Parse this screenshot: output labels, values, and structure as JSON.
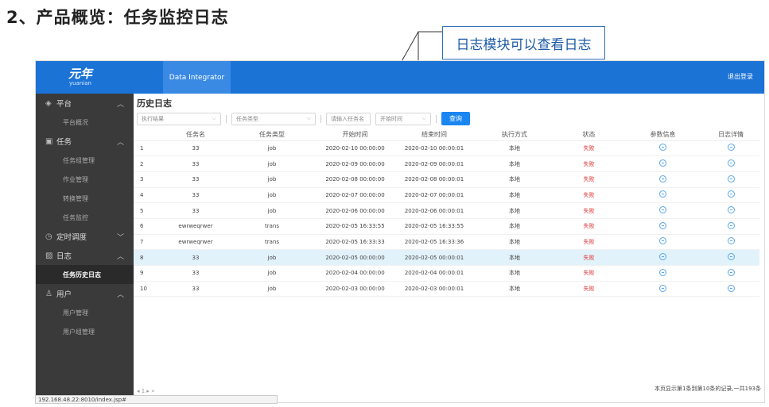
{
  "slide": {
    "title": "2、产品概览：任务监控日志"
  },
  "callout": {
    "text": "日志模块可以查看日志"
  },
  "app": {
    "logo": {
      "zh": "元年",
      "en": "yuanian"
    },
    "product_tab": "Data Integrator",
    "logout": "退出登录"
  },
  "sidebar": {
    "groups": [
      {
        "label": "平台",
        "icon": "layers-icon",
        "chevron": "up",
        "items": [
          {
            "label": "平台概况"
          }
        ]
      },
      {
        "label": "任务",
        "icon": "calendar-icon",
        "chevron": "up",
        "items": [
          {
            "label": "任务组管理"
          },
          {
            "label": "作业管理"
          },
          {
            "label": "转换管理"
          },
          {
            "label": "任务监控"
          }
        ]
      },
      {
        "label": "定时调度",
        "icon": "clock-icon",
        "chevron": "down",
        "items": []
      },
      {
        "label": "日志",
        "icon": "log-icon",
        "chevron": "up",
        "items": [
          {
            "label": "任务历史日志",
            "active": true
          }
        ]
      },
      {
        "label": "用户",
        "icon": "user-icon",
        "chevron": "up",
        "items": [
          {
            "label": "用户管理"
          },
          {
            "label": "用户组管理"
          }
        ]
      }
    ]
  },
  "main": {
    "heading": "历史日志",
    "filters": {
      "result": "执行结果",
      "task_type": "任务类型",
      "task_name_placeholder": "请输入任务名",
      "start_time": "开始时间",
      "query": "查询"
    },
    "columns": [
      "",
      "任务名",
      "任务类型",
      "开始时间",
      "结束时间",
      "执行方式",
      "状态",
      "参数信息",
      "日志详情"
    ],
    "rows": [
      {
        "no": "1",
        "name": "33",
        "type": "job",
        "start": "2020-02-10 00:00:00",
        "end": "2020-02-10 00:00:01",
        "mode": "本地",
        "status": "失败"
      },
      {
        "no": "2",
        "name": "33",
        "type": "job",
        "start": "2020-02-09 00:00:00",
        "end": "2020-02-09 00:00:01",
        "mode": "本地",
        "status": "失败"
      },
      {
        "no": "3",
        "name": "33",
        "type": "job",
        "start": "2020-02-08 00:00:00",
        "end": "2020-02-08 00:00:01",
        "mode": "本地",
        "status": "失败"
      },
      {
        "no": "4",
        "name": "33",
        "type": "job",
        "start": "2020-02-07 00:00:00",
        "end": "2020-02-07 00:00:01",
        "mode": "本地",
        "status": "失败"
      },
      {
        "no": "5",
        "name": "33",
        "type": "job",
        "start": "2020-02-06 00:00:00",
        "end": "2020-02-06 00:00:01",
        "mode": "本地",
        "status": "失败"
      },
      {
        "no": "6",
        "name": "ewrweqrwer",
        "type": "trans",
        "start": "2020-02-05 16:33:55",
        "end": "2020-02-05 16:33:55",
        "mode": "本地",
        "status": "失败"
      },
      {
        "no": "7",
        "name": "ewrweqrwer",
        "type": "trans",
        "start": "2020-02-05 16:33:33",
        "end": "2020-02-05 16:33:36",
        "mode": "本地",
        "status": "失败"
      },
      {
        "no": "8",
        "name": "33",
        "type": "job",
        "start": "2020-02-05 00:00:00",
        "end": "2020-02-05 00:00:01",
        "mode": "本地",
        "status": "失败",
        "highlight": true
      },
      {
        "no": "9",
        "name": "33",
        "type": "job",
        "start": "2020-02-04 00:00:00",
        "end": "2020-02-04 00:00:01",
        "mode": "本地",
        "status": "失败"
      },
      {
        "no": "10",
        "name": "33",
        "type": "job",
        "start": "2020-02-03 00:00:00",
        "end": "2020-02-03 00:00:01",
        "mode": "本地",
        "status": "失败"
      }
    ],
    "footer_info": "本页显示第1条到第10条的记录,一共193条"
  },
  "status_bar": {
    "url": "192.168.48.22:8010/index.jsp#"
  },
  "colors": {
    "topbar": "#1b73d6",
    "sidebar": "#3a3a3a",
    "fail": "#e03030",
    "highlight_row": "#e2f2fb",
    "query_button": "#1b86f2"
  }
}
